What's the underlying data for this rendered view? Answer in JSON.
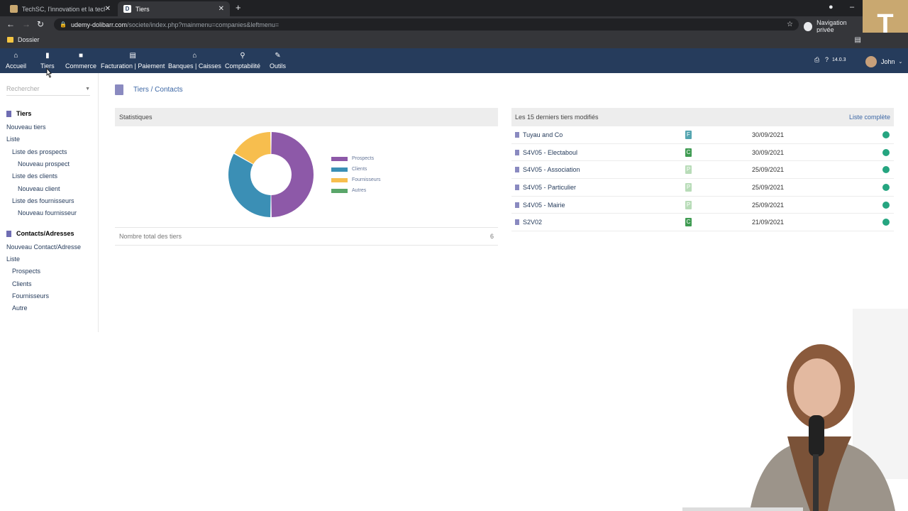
{
  "browser": {
    "tabs": [
      {
        "title": "TechSC, l'innovation et la technic",
        "active": false
      },
      {
        "title": "Tiers",
        "active": true
      }
    ],
    "url_host": "udemy-dolibarr.com",
    "url_path": "/societe/index.php?mainmenu=companies&leftmenu=",
    "incognito_label": "Navigation privée",
    "bookmark_folder": "Dossier"
  },
  "topmenu": {
    "items": [
      {
        "label": "Accueil",
        "icon": "home-icon"
      },
      {
        "label": "Tiers",
        "icon": "building-icon"
      },
      {
        "label": "Commerce",
        "icon": "briefcase-icon"
      },
      {
        "label": "Facturation | Paiement",
        "icon": "invoice-icon"
      },
      {
        "label": "Banques | Caisses",
        "icon": "bank-icon"
      },
      {
        "label": "Comptabilité",
        "icon": "search-icon"
      },
      {
        "label": "Outils",
        "icon": "wrench-icon"
      }
    ],
    "version": "14.0.3",
    "user": "John"
  },
  "sidebar": {
    "search_placeholder": "Rechercher",
    "sections": [
      {
        "title": "Tiers",
        "items": [
          {
            "label": "Nouveau tiers",
            "level": 0
          },
          {
            "label": "Liste",
            "level": 0
          },
          {
            "label": "Liste des prospects",
            "level": 1
          },
          {
            "label": "Nouveau prospect",
            "level": 2
          },
          {
            "label": "Liste des clients",
            "level": 1
          },
          {
            "label": "Nouveau client",
            "level": 2
          },
          {
            "label": "Liste des fournisseurs",
            "level": 1
          },
          {
            "label": "Nouveau fournisseur",
            "level": 2
          }
        ]
      },
      {
        "title": "Contacts/Adresses",
        "items": [
          {
            "label": "Nouveau Contact/Adresse",
            "level": 0
          },
          {
            "label": "Liste",
            "level": 0
          },
          {
            "label": "Prospects",
            "level": 1
          },
          {
            "label": "Clients",
            "level": 1
          },
          {
            "label": "Fournisseurs",
            "level": 1
          },
          {
            "label": "Autre",
            "level": 1
          }
        ]
      }
    ]
  },
  "main": {
    "breadcrumb": "Tiers / Contacts",
    "stats": {
      "title": "Statistiques",
      "total_label": "Nombre total des tiers",
      "total_value": "6"
    },
    "recent": {
      "title": "Les 15 derniers tiers modifiés",
      "full_list_link": "Liste complète",
      "rows": [
        {
          "name": "Tuyau and Co",
          "badge": "F",
          "badge_color": "#55a5b0",
          "date": "30/09/2021"
        },
        {
          "name": "S4V05 - Electaboul",
          "badge": "C",
          "badge_color": "#3f9b52",
          "date": "30/09/2021"
        },
        {
          "name": "S4V05 - Association",
          "badge": "P",
          "badge_color": "#b8dcb8",
          "date": "25/09/2021"
        },
        {
          "name": "S4V05 - Particulier",
          "badge": "P",
          "badge_color": "#b8dcb8",
          "date": "25/09/2021"
        },
        {
          "name": "S4V05 - Mairie",
          "badge": "P",
          "badge_color": "#b8dcb8",
          "date": "25/09/2021"
        },
        {
          "name": "S2V02",
          "badge": "C",
          "badge_color": "#3f9b52",
          "date": "21/09/2021"
        }
      ]
    }
  },
  "chart_data": {
    "type": "pie",
    "donut": true,
    "categories": [
      "Prospects",
      "Clients",
      "Fournisseurs",
      "Autres"
    ],
    "values": [
      3,
      2,
      1,
      0
    ],
    "colors": [
      "#8d59a8",
      "#3b8fb5",
      "#f7be4e",
      "#5aa66a"
    ],
    "legend_position": "right"
  }
}
